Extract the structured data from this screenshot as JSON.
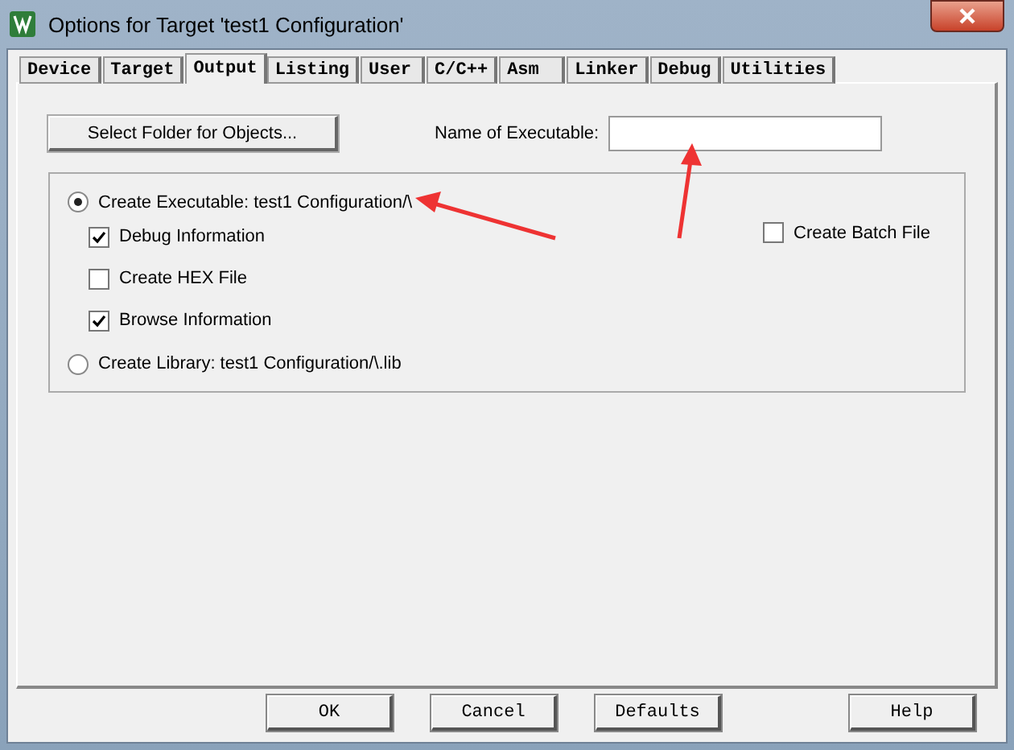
{
  "window": {
    "title": "Options for Target 'test1 Configuration'"
  },
  "tabs": [
    {
      "label": "Device",
      "selected": false
    },
    {
      "label": "Target",
      "selected": false
    },
    {
      "label": "Output",
      "selected": true
    },
    {
      "label": "Listing",
      "selected": false
    },
    {
      "label": "User",
      "selected": false
    },
    {
      "label": "C/C++",
      "selected": false
    },
    {
      "label": "Asm",
      "selected": false
    },
    {
      "label": "Linker",
      "selected": false
    },
    {
      "label": "Debug",
      "selected": false
    },
    {
      "label": "Utilities",
      "selected": false
    }
  ],
  "output": {
    "select_folder_button": "Select Folder for Objects...",
    "executable_name_label": "Name of Executable:",
    "create_executable": {
      "label": "Create Executable:  test1 Configuration/\\",
      "selected": true
    },
    "executable_options": [
      {
        "label": "Debug Information",
        "checked": true
      },
      {
        "label": "Create HEX File",
        "checked": false
      },
      {
        "label": "Browse Information",
        "checked": true
      }
    ],
    "create_batch_file": {
      "label": "Create Batch File",
      "checked": false
    },
    "create_library": {
      "label": "Create Library:  test1 Configuration/\\.lib",
      "selected": false
    }
  },
  "buttons": [
    {
      "label": "OK"
    },
    {
      "label": "Cancel"
    },
    {
      "label": "Defaults"
    },
    {
      "label": "Help"
    }
  ]
}
